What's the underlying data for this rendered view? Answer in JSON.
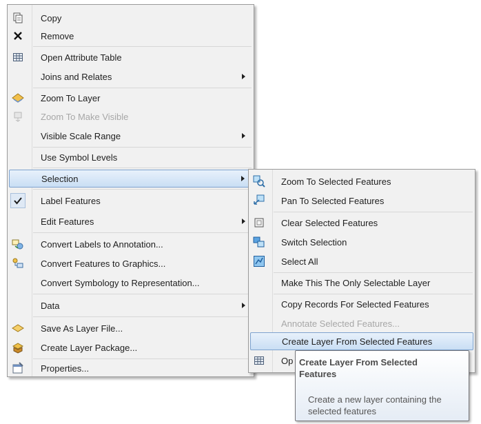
{
  "context_menu": {
    "items": [
      {
        "label": "Copy",
        "icon": "copy-icon"
      },
      {
        "label": "Remove",
        "icon": "remove-icon"
      },
      {
        "label": "Open Attribute Table",
        "icon": "table-icon"
      },
      {
        "label": "Joins and Relates",
        "has_submenu": true
      },
      {
        "label": "Zoom To Layer",
        "icon": "zoom-to-layer-icon"
      },
      {
        "label": "Zoom To Make Visible",
        "icon": "zoom-to-make-visible-icon",
        "disabled": true
      },
      {
        "label": "Visible Scale Range",
        "has_submenu": true
      },
      {
        "label": "Use Symbol Levels"
      },
      {
        "label": "Selection",
        "has_submenu": true,
        "highlighted": true
      },
      {
        "label": "Label Features",
        "checked": true
      },
      {
        "label": "Edit Features",
        "has_submenu": true
      },
      {
        "label": "Convert Labels to Annotation...",
        "icon": "convert-labels-icon"
      },
      {
        "label": "Convert Features to Graphics...",
        "icon": "convert-features-icon"
      },
      {
        "label": "Convert Symbology to Representation..."
      },
      {
        "label": "Data",
        "has_submenu": true
      },
      {
        "label": "Save As Layer File...",
        "icon": "layer-file-icon"
      },
      {
        "label": "Create Layer Package...",
        "icon": "layer-package-icon"
      },
      {
        "label": "Properties...",
        "icon": "properties-icon"
      }
    ]
  },
  "selection_submenu": {
    "items": [
      {
        "label": "Zoom To Selected Features",
        "icon": "zoom-to-selected-icon"
      },
      {
        "label": "Pan To Selected Features",
        "icon": "pan-to-selected-icon"
      },
      {
        "label": "Clear Selected Features",
        "icon": "clear-selection-icon"
      },
      {
        "label": "Switch Selection",
        "icon": "switch-selection-icon"
      },
      {
        "label": "Select All",
        "icon": "select-all-icon"
      },
      {
        "label": "Make This The Only Selectable Layer"
      },
      {
        "label": "Copy Records For Selected Features"
      },
      {
        "label": "Annotate Selected Features...",
        "disabled": true
      },
      {
        "label": "Create Layer From Selected Features",
        "highlighted": true
      },
      {
        "label": "Op",
        "icon": "table-icon"
      }
    ]
  },
  "tooltip": {
    "title": "Create Layer From Selected Features",
    "description": "Create a new layer containing the selected features"
  },
  "colors": {
    "menu_background": "#f1f1f1",
    "highlight_top": "#e8f1fb",
    "highlight_bottom": "#c9def4",
    "highlight_border": "#7da2ce",
    "disabled_text": "#a7a7a7"
  }
}
